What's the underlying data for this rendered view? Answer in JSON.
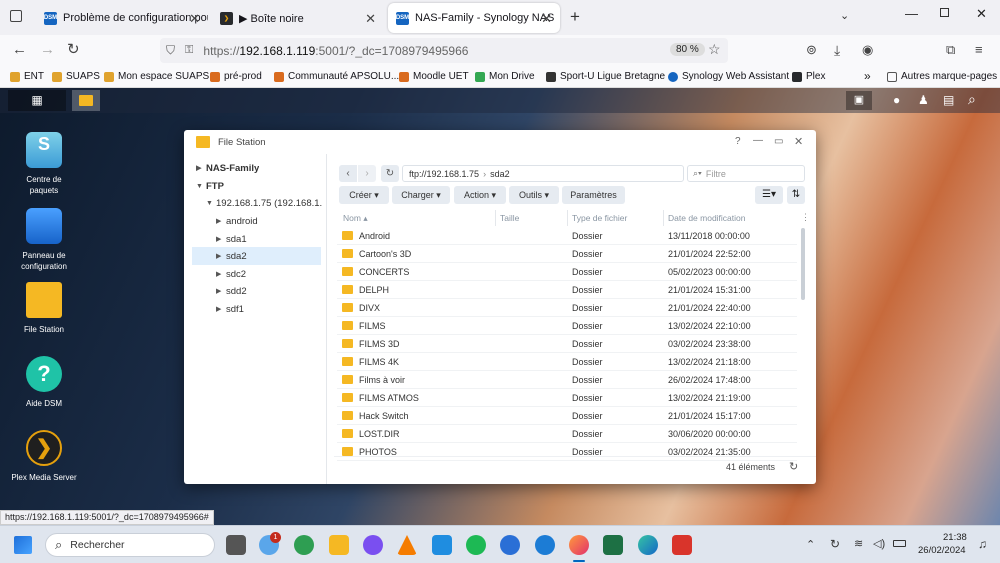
{
  "tabs": [
    {
      "label": "Problème de configuration pou",
      "icon": "dsm-icon",
      "color": "#1565c0"
    },
    {
      "label": "▶ Boîte noire",
      "icon": "plex-icon",
      "color": "#282a2d"
    },
    {
      "label": "NAS-Family - Synology NAS",
      "icon": "dsm-icon",
      "color": "#1565c0"
    }
  ],
  "url": {
    "prefix": "https://",
    "host": "192.168.1.119",
    "rest": ":5001/?_dc=1708979495966",
    "zoom": "80 %"
  },
  "bookmarks": [
    "ENT",
    "SUAPS",
    "Mon espace SUAPS",
    "pré-prod",
    "Communauté APSOLU...",
    "Moodle UET",
    "Mon Drive",
    "Sport-U Ligue Bretagne",
    "Synology Web Assistant",
    "Plex",
    "Autres marque-pages"
  ],
  "desktop_icons": [
    {
      "label": "Centre de paquets"
    },
    {
      "label": "Panneau de configuration"
    },
    {
      "label": "File Station"
    },
    {
      "label": "Aide DSM"
    },
    {
      "label": "Plex Media Server"
    }
  ],
  "window": {
    "title": "File Station"
  },
  "tree": {
    "root1": "NAS-Family",
    "root2": "FTP",
    "server": "192.168.1.75 (192.168.1.",
    "items": [
      "android",
      "sda1",
      "sda2",
      "sdc2",
      "sdd2",
      "sdf1"
    ]
  },
  "path": {
    "ftp": "ftp://192.168.1.75",
    "folder": "sda2"
  },
  "filter_placeholder": "Filtre",
  "toolbar": {
    "create": "Créer",
    "upload": "Charger",
    "action": "Action",
    "tools": "Outils",
    "settings": "Paramètres"
  },
  "columns": {
    "name": "Nom",
    "size": "Taille",
    "type": "Type de fichier",
    "date": "Date de modification"
  },
  "files": [
    {
      "name": "Android",
      "type": "Dossier",
      "date": "13/11/2018 00:00:00"
    },
    {
      "name": "Cartoon's 3D",
      "type": "Dossier",
      "date": "21/01/2024 22:52:00"
    },
    {
      "name": "CONCERTS",
      "type": "Dossier",
      "date": "05/02/2023 00:00:00"
    },
    {
      "name": "DELPH",
      "type": "Dossier",
      "date": "21/01/2024 15:31:00"
    },
    {
      "name": "DIVX",
      "type": "Dossier",
      "date": "21/01/2024 22:40:00"
    },
    {
      "name": "FILMS",
      "type": "Dossier",
      "date": "13/02/2024 22:10:00"
    },
    {
      "name": "FILMS 3D",
      "type": "Dossier",
      "date": "03/02/2024 23:38:00"
    },
    {
      "name": "FILMS 4K",
      "type": "Dossier",
      "date": "13/02/2024 21:18:00"
    },
    {
      "name": "Films à voir",
      "type": "Dossier",
      "date": "26/02/2024 17:48:00"
    },
    {
      "name": "FILMS ATMOS",
      "type": "Dossier",
      "date": "13/02/2024 21:19:00"
    },
    {
      "name": "Hack Switch",
      "type": "Dossier",
      "date": "21/01/2024 15:17:00"
    },
    {
      "name": "LOST.DIR",
      "type": "Dossier",
      "date": "30/06/2020 00:00:00"
    },
    {
      "name": "PHOTOS",
      "type": "Dossier",
      "date": "03/02/2024 21:35:00"
    }
  ],
  "item_count": "41 éléments",
  "status_url": "https://192.168.1.119:5001/?_dc=1708979495966#",
  "taskbar": {
    "search": "Rechercher",
    "time": "21:38",
    "date": "26/02/2024",
    "badge": "1"
  }
}
